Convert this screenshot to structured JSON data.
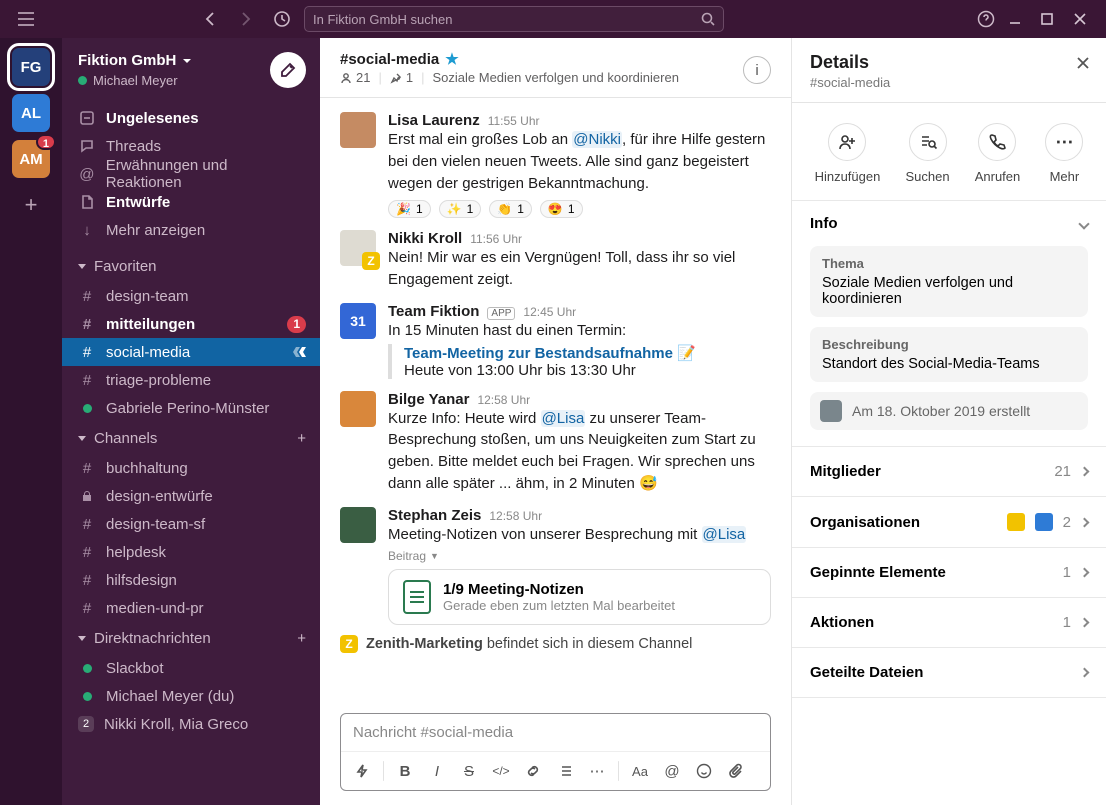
{
  "titlebar": {
    "search_placeholder": "In Fiktion GmbH suchen"
  },
  "workspaces": [
    {
      "initials": "FG",
      "color": "#24407a",
      "selected": true
    },
    {
      "initials": "AL",
      "color": "#2e7bd6"
    },
    {
      "initials": "AM",
      "color": "#d3803b",
      "badge": "1"
    }
  ],
  "sidebar": {
    "workspace_name": "Fiktion GmbH",
    "me_name": "Michael Meyer",
    "top_items": [
      {
        "icon": "inbox",
        "label": "Ungelesenes",
        "bold": true
      },
      {
        "icon": "threads",
        "label": "Threads"
      },
      {
        "icon": "at",
        "label": "Erwähnungen und Reaktionen"
      },
      {
        "icon": "drafts",
        "label": "Entwürfe",
        "bold": true
      },
      {
        "icon": "more",
        "label": "Mehr anzeigen"
      }
    ],
    "fav_header": "Favoriten",
    "favorites": [
      {
        "prefix": "#",
        "label": "design-team"
      },
      {
        "prefix": "#",
        "label": "mitteilungen",
        "bold": true,
        "badge": "1"
      },
      {
        "prefix": "#",
        "label": "social-media",
        "selected": true
      },
      {
        "prefix": "#",
        "label": "triage-probleme"
      },
      {
        "prefix": "●",
        "label": "Gabriele Perino-Münster",
        "presence": true
      }
    ],
    "channels_header": "Channels",
    "channels": [
      {
        "prefix": "#",
        "label": "buchhaltung"
      },
      {
        "prefix": "lock",
        "label": "design-entwürfe"
      },
      {
        "prefix": "#",
        "label": "design-team-sf"
      },
      {
        "prefix": "#",
        "label": "helpdesk"
      },
      {
        "prefix": "#",
        "label": "hilfsdesign"
      },
      {
        "prefix": "#",
        "label": "medien-und-pr"
      }
    ],
    "dm_header": "Direktnachrichten",
    "dms": [
      {
        "label": "Slackbot",
        "presence": true
      },
      {
        "label": "Michael Meyer (du)",
        "presence": true
      },
      {
        "label": "Nikki Kroll, Mia Greco",
        "count": "2"
      }
    ]
  },
  "channel": {
    "name": "#social-media",
    "members": "21",
    "pins": "1",
    "topic": "Soziale Medien verfolgen und koordinieren"
  },
  "messages": [
    {
      "author": "Lisa Laurenz",
      "time": "11:55 Uhr",
      "avatar_bg": "#c58b63",
      "pre": "Erst mal ein großes Lob an ",
      "mention": "@Nikki",
      "post": ", für ihre Hilfe gestern bei den vielen neuen Tweets. Alle sind ganz begeistert wegen der gestrigen Bekanntmachung.",
      "reactions": [
        [
          "🎉",
          "1"
        ],
        [
          "✨",
          "1"
        ],
        [
          "👏",
          "1"
        ],
        [
          "😍",
          "1"
        ]
      ]
    },
    {
      "author": "Nikki Kroll",
      "time": "11:56 Uhr",
      "avatar_bg": "#dedbd2",
      "z": true,
      "text": "Nein! Mir war es ein Vergnügen! Toll, dass ihr so viel Engagement zeigt."
    },
    {
      "author": "Team Fiktion",
      "time": "12:45 Uhr",
      "app": "APP",
      "avatar_bg": "#3367d6",
      "cal": true,
      "text": "In 15 Minuten hast du einen Termin:",
      "event_title": "Team-Meeting zur Bestandsaufnahme",
      "event_emoji": "📝",
      "event_time": "Heute von 13:00 Uhr bis 13:30 Uhr"
    },
    {
      "author": "Bilge Yanar",
      "time": "12:58 Uhr",
      "avatar_bg": "#d9873b",
      "pre": "Kurze Info: Heute wird ",
      "mention": "@Lisa",
      "post": " zu unserer Team-Besprechung stoßen, um uns Neuigkeiten zum Start zu geben. Bitte meldet euch bei Fragen. Wir sprechen uns dann alle später ... ähm, in 2 Minuten 😅"
    },
    {
      "author": "Stephan Zeis",
      "time": "12:58 Uhr",
      "avatar_bg": "#3a5e43",
      "pre": "Meeting-Notizen von unserer Besprechung mit ",
      "mention": "@Lisa",
      "post": "",
      "post_label": "Beitrag",
      "doc_title": "1/9 Meeting-Notizen",
      "doc_sub": "Gerade eben zum letzten Mal bearbeitet"
    }
  ],
  "in_channel": {
    "who": "Zenith-Marketing",
    "rest": "befindet sich in diesem Channel"
  },
  "composer": {
    "placeholder": "Nachricht #social-media"
  },
  "details": {
    "title": "Details",
    "sub": "#social-media",
    "actions": {
      "add": "Hinzufügen",
      "search": "Suchen",
      "call": "Anrufen",
      "more": "Mehr"
    },
    "info_hdr": "Info",
    "topic_label": "Thema",
    "topic": "Soziale Medien verfolgen und koordinieren",
    "desc_label": "Beschreibung",
    "desc": "Standort des Social-Media-Teams",
    "created": "Am 18. Oktober 2019 erstellt",
    "rows": {
      "members": {
        "label": "Mitglieder",
        "value": "21"
      },
      "orgs": {
        "label": "Organisationen",
        "value": "2"
      },
      "pinned": {
        "label": "Gepinnte Elemente",
        "value": "1"
      },
      "actions": {
        "label": "Aktionen",
        "value": "1"
      },
      "files": {
        "label": "Geteilte Dateien",
        "value": ""
      }
    }
  }
}
